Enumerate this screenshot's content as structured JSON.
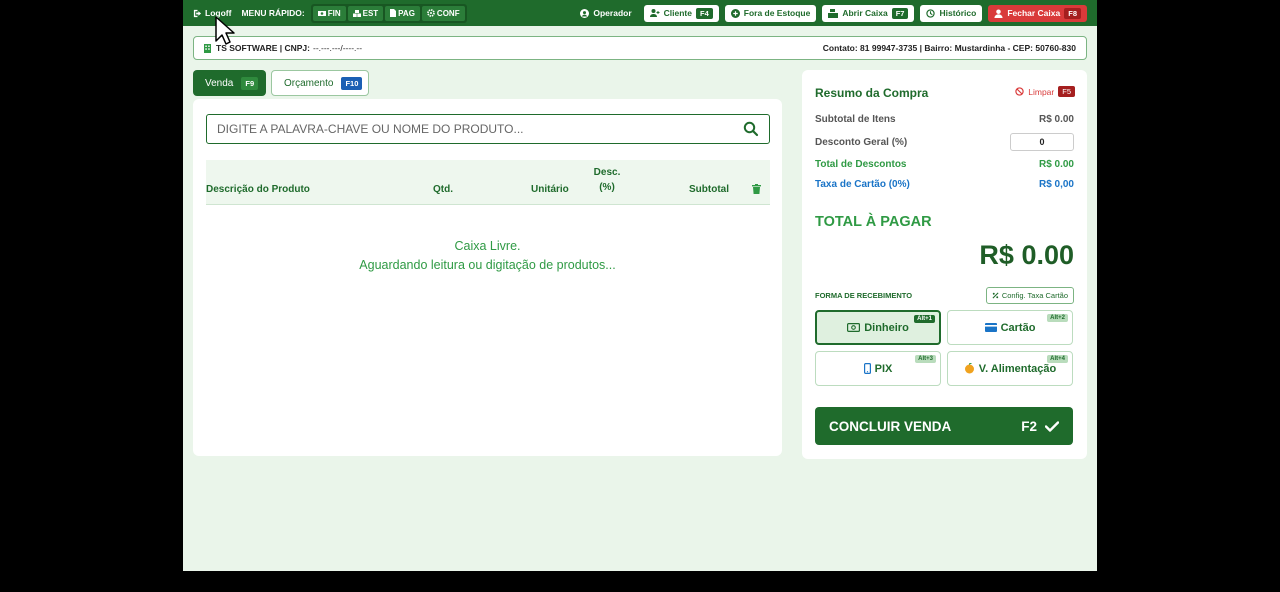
{
  "topbar": {
    "logoff": "Logoff",
    "menu_label": "MENU RÁPIDO:",
    "quick": [
      {
        "label": "FIN",
        "icon": "money-icon"
      },
      {
        "label": "EST",
        "icon": "boxes-icon"
      },
      {
        "label": "PAG",
        "icon": "document-icon"
      },
      {
        "label": "CONF",
        "icon": "gear-icon"
      }
    ],
    "operator": "Operador",
    "cliente": {
      "label": "Cliente",
      "key": "F4"
    },
    "fora_estoque": "Fora de Estoque",
    "abrir_caixa": {
      "label": "Abrir Caixa",
      "key": "F7"
    },
    "historico": "Histórico",
    "fechar_caixa": {
      "label": "Fechar Caixa",
      "key": "F8"
    }
  },
  "info": {
    "company": "TS SOFTWARE | CNPJ:",
    "cnpj": "--.---.---/----.--",
    "contact": "Contato: 81 99947-3735 | Bairro: Mustardinha - CEP: 50760-830"
  },
  "tabs": {
    "venda": {
      "label": "Venda",
      "key": "F9"
    },
    "orcamento": {
      "label": "Orçamento",
      "key": "F10"
    }
  },
  "search": {
    "placeholder": "DIGITE A PALAVRA-CHAVE OU NOME DO PRODUTO..."
  },
  "table": {
    "headers": {
      "descricao": "Descrição do Produto",
      "qtd": "Qtd.",
      "unitario": "Unitário",
      "desc_line1": "Desc.",
      "desc_line2": "(%)",
      "subtotal": "Subtotal"
    },
    "empty_line1": "Caixa Livre.",
    "empty_line2": "Aguardando leitura ou digitação de produtos..."
  },
  "summary": {
    "title": "Resumo da Compra",
    "limpar": {
      "label": "Limpar",
      "key": "F5"
    },
    "subtotal_label": "Subtotal de Itens",
    "subtotal_value": "R$ 0.00",
    "desconto_label": "Desconto Geral (%)",
    "desconto_value": "0",
    "total_desc_label": "Total de Descontos",
    "total_desc_value": "R$ 0.00",
    "taxa_label": "Taxa de Cartão (0%)",
    "taxa_value": "R$ 0,00",
    "total_label": "TOTAL À PAGAR",
    "total_value": "R$ 0.00",
    "forma_label": "FORMA DE RECEBIMENTO",
    "config_label": "Config. Taxa Cartão",
    "payments": [
      {
        "label": "Dinheiro",
        "key": "Alt+1"
      },
      {
        "label": "Cartão",
        "key": "Alt+2"
      },
      {
        "label": "PIX",
        "key": "Alt+3"
      },
      {
        "label": "V. Alimentação",
        "key": "Alt+4"
      }
    ],
    "concluir": {
      "label": "CONCLUIR VENDA",
      "key": "F2"
    }
  },
  "colors": {
    "primary": "#1f6b2c",
    "accent_green": "#2f9a44",
    "danger": "#d93a3a",
    "info_blue": "#1a74c7",
    "background": "#eaf5ea"
  }
}
